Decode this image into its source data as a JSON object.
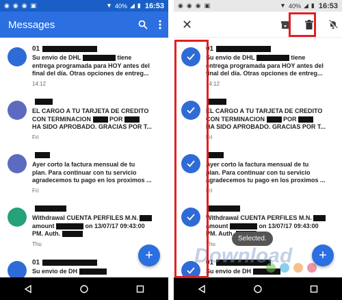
{
  "colors": {
    "accent": "#2b6fe0",
    "status_bar_left": "#1a5fc7",
    "highlight": "#e01e25",
    "avatar_blue": "#2f6bd6",
    "avatar_purple": "#5c6bc0",
    "avatar_green": "#26a17a"
  },
  "status": {
    "time": "16:53",
    "battery": "40%"
  },
  "left": {
    "title": "Messages",
    "search_icon": "search-icon",
    "menu_icon": "more-vert-icon",
    "messages": [
      {
        "sender": "01",
        "body": [
          "Su envio de DHL",
          "tiene",
          "entrega programada para HOY antes del",
          "final del día. Otras opciones de entreg..."
        ],
        "time": "14:12",
        "avatar_color": "#2f6bd6"
      },
      {
        "sender": "",
        "body": [
          "EL CARGO A TU TARJETA DE CREDITO",
          "CON TERMINACION",
          "POR",
          "HA SIDO APROBADO. GRACIAS POR T..."
        ],
        "time": "Fri",
        "avatar_color": "#5c6bc0"
      },
      {
        "sender": "",
        "body": [
          "Ayer corto la factura mensual de tu",
          "plan. Para continuar con tu servicio",
          "agradecemos tu pago en los proximos ..."
        ],
        "time": "Fri",
        "avatar_color": "#5c6bc0"
      },
      {
        "sender": "",
        "body": [
          "Withdrawal CUENTA PERFILES M.N.",
          "amount",
          "on 13/07/17 09:43:00",
          "PM. Auth."
        ],
        "time": "Thu",
        "avatar_color": "#26a17a"
      },
      {
        "sender": "01",
        "body": [
          "Su envio de DH"
        ],
        "time": "",
        "avatar_color": "#2f6bd6"
      }
    ],
    "fab_label": "+"
  },
  "right": {
    "close_label": "✕",
    "archive_icon": "archive-icon",
    "delete_icon": "trash-icon",
    "mute_icon": "notifications-off-icon",
    "toast": "Selected.",
    "fab_label": "+"
  },
  "watermark": "Download"
}
